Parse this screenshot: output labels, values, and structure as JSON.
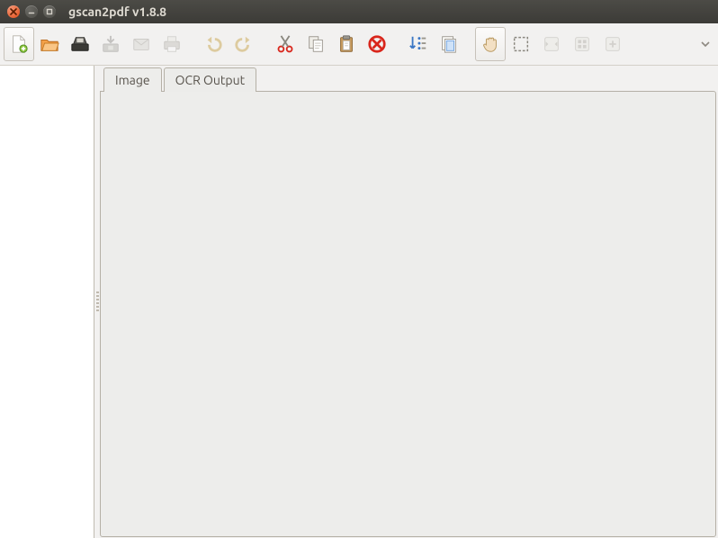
{
  "window": {
    "title": "gscan2pdf v1.8.8"
  },
  "toolbar": {
    "items": [
      {
        "name": "new-doc-icon"
      },
      {
        "name": "open-icon"
      },
      {
        "name": "scan-icon"
      },
      {
        "name": "save-icon",
        "disabled": true
      },
      {
        "name": "email-icon",
        "disabled": true
      },
      {
        "name": "print-icon",
        "disabled": true
      },
      {
        "sep": true
      },
      {
        "name": "undo-icon",
        "disabled": true
      },
      {
        "name": "redo-icon",
        "disabled": true
      },
      {
        "sep": true
      },
      {
        "name": "cut-icon"
      },
      {
        "name": "copy-icon"
      },
      {
        "name": "paste-icon"
      },
      {
        "name": "delete-icon"
      },
      {
        "sep": true
      },
      {
        "name": "renumber-icon"
      },
      {
        "name": "select-all-icon"
      },
      {
        "sep": true
      },
      {
        "name": "hand-tool-icon"
      },
      {
        "name": "select-region-icon"
      },
      {
        "name": "zoom-fit-icon",
        "disabled": true
      },
      {
        "name": "zoom-100-icon",
        "disabled": true
      },
      {
        "name": "zoom-in-icon",
        "disabled": true
      }
    ]
  },
  "tabs": {
    "items": [
      {
        "label": "Image",
        "active": true
      },
      {
        "label": "OCR Output",
        "active": false
      }
    ]
  }
}
